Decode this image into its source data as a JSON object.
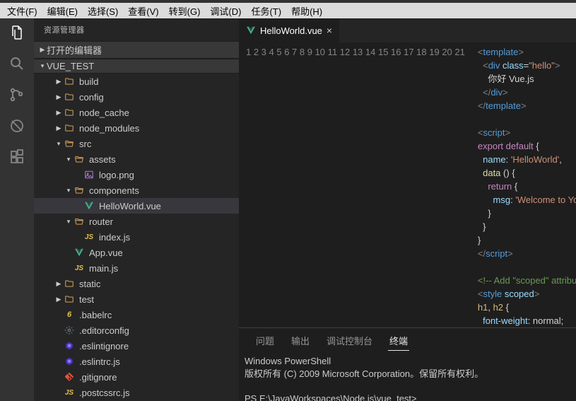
{
  "menu": {
    "file": "文件(F)",
    "edit": "编辑(E)",
    "select": "选择(S)",
    "view": "查看(V)",
    "goto": "转到(G)",
    "debug": "调试(D)",
    "task": "任务(T)",
    "help": "帮助(H)"
  },
  "sidebar": {
    "title": "资源管理器",
    "open_editors": "打开的编辑器",
    "project": "VUE_TEST",
    "tree": [
      {
        "t": "f",
        "l": "build",
        "d": 2
      },
      {
        "t": "f",
        "l": "config",
        "d": 2
      },
      {
        "t": "f",
        "l": "node_cache",
        "d": 2
      },
      {
        "t": "f",
        "l": "node_modules",
        "d": 2
      },
      {
        "t": "fo",
        "l": "src",
        "d": 2
      },
      {
        "t": "fo",
        "l": "assets",
        "d": 3
      },
      {
        "t": "img",
        "l": "logo.png",
        "d": 4
      },
      {
        "t": "fo",
        "l": "components",
        "d": 3
      },
      {
        "t": "vue",
        "l": "HelloWorld.vue",
        "d": 4,
        "sel": true
      },
      {
        "t": "fo",
        "l": "router",
        "d": 3
      },
      {
        "t": "js",
        "l": "index.js",
        "d": 4
      },
      {
        "t": "vue",
        "l": "App.vue",
        "d": 3
      },
      {
        "t": "js",
        "l": "main.js",
        "d": 3
      },
      {
        "t": "f",
        "l": "static",
        "d": 2
      },
      {
        "t": "f",
        "l": "test",
        "d": 2
      },
      {
        "t": "babel",
        "l": ".babelrc",
        "d": 2
      },
      {
        "t": "cfg",
        "l": ".editorconfig",
        "d": 2
      },
      {
        "t": "esl",
        "l": ".eslintignore",
        "d": 2
      },
      {
        "t": "esl",
        "l": ".eslintrc.js",
        "d": 2
      },
      {
        "t": "git",
        "l": ".gitignore",
        "d": 2
      },
      {
        "t": "js",
        "l": ".postcssrc.js",
        "d": 2
      }
    ]
  },
  "tab": {
    "name": "HelloWorld.vue"
  },
  "code_lines": 21,
  "panel": {
    "tabs": {
      "problems": "问题",
      "output": "输出",
      "debug": "调试控制台",
      "terminal": "终端"
    },
    "term_line1": "Windows PowerShell",
    "term_line2": "版权所有 (C) 2009 Microsoft Corporation。保留所有权利。",
    "term_prompt": "PS E:\\JavaWorkspaces\\Node.js\\vue_test>"
  }
}
